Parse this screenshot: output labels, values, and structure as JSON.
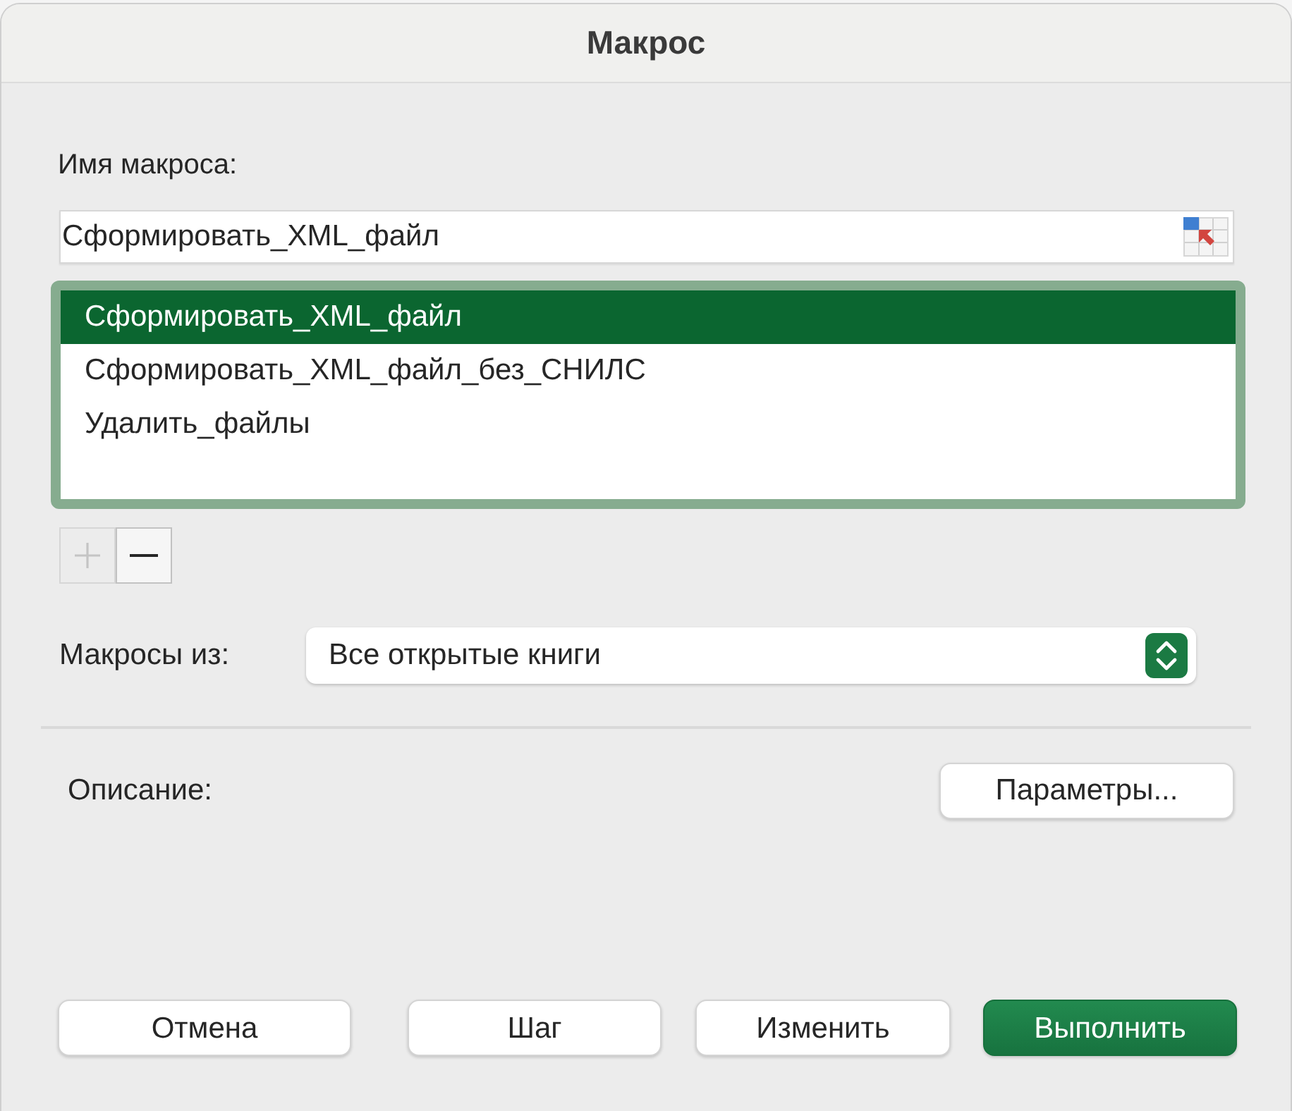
{
  "window": {
    "title": "Макрос"
  },
  "macro_name": {
    "label": "Имя макроса:",
    "value": "Сформировать_XML_файл"
  },
  "macro_list": {
    "items": [
      {
        "label": "Сформировать_XML_файл",
        "selected": true
      },
      {
        "label": "Сформировать_XML_файл_без_СНИЛС",
        "selected": false
      },
      {
        "label": "Удалить_файлы",
        "selected": false
      }
    ]
  },
  "list_buttons": [
    {
      "kind": "add",
      "disabled": true
    },
    {
      "kind": "remove",
      "disabled": false
    }
  ],
  "macros_in": {
    "label": "Макросы из:",
    "value": "Все открытые книги"
  },
  "description": {
    "label": "Описание:"
  },
  "options_button": {
    "label": "Параметры..."
  },
  "buttons": [
    {
      "label": "Отмена",
      "kind": "default"
    },
    {
      "label": "Шаг",
      "kind": "default"
    },
    {
      "label": "Изменить",
      "kind": "default"
    },
    {
      "label": "Выполнить",
      "kind": "primary"
    }
  ]
}
